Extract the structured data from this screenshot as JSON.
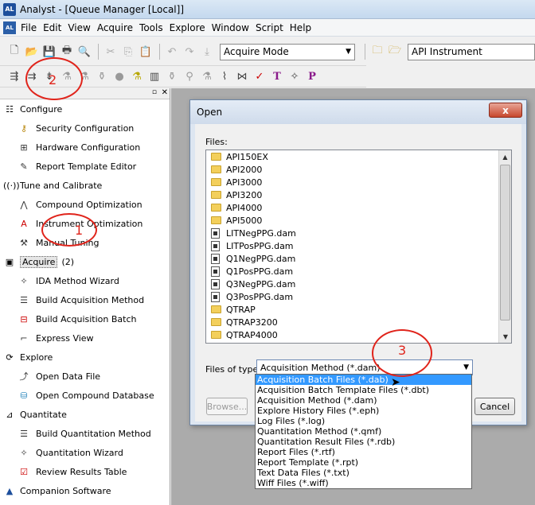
{
  "window": {
    "title": "Analyst - [Queue Manager [Local]]",
    "app_icon": "AL"
  },
  "menu": {
    "items": [
      "File",
      "Edit",
      "View",
      "Acquire",
      "Tools",
      "Explore",
      "Window",
      "Script",
      "Help"
    ]
  },
  "toolbar": {
    "mode_value": "Acquire Mode",
    "instrument_value": "API Instrument"
  },
  "sidebar": {
    "groups": [
      {
        "label": "Configure",
        "items": [
          "Security Configuration",
          "Hardware Configuration",
          "Report Template Editor"
        ]
      },
      {
        "label": "Tune and Calibrate",
        "items": [
          "Compound Optimization",
          "Instrument Optimization",
          "Manual Tuning"
        ]
      },
      {
        "label": "Acquire",
        "items": [
          "IDA Method Wizard",
          "Build Acquisition Method",
          "Build Acquisition Batch",
          "Express View"
        ]
      },
      {
        "label": "Explore",
        "items": [
          "Open Data File",
          "Open Compound Database"
        ]
      },
      {
        "label": "Quantitate",
        "items": [
          "Build Quantitation Method",
          "Quantitation Wizard",
          "Review Results Table"
        ]
      },
      {
        "label": "Companion Software",
        "items": []
      }
    ]
  },
  "dialog": {
    "title": "Open",
    "close_label": "x",
    "files_label": "Files:",
    "files": [
      {
        "name": "API150EX",
        "kind": "folder"
      },
      {
        "name": "API2000",
        "kind": "folder"
      },
      {
        "name": "API3000",
        "kind": "folder"
      },
      {
        "name": "API3200",
        "kind": "folder"
      },
      {
        "name": "API4000",
        "kind": "folder"
      },
      {
        "name": "API5000",
        "kind": "folder"
      },
      {
        "name": "LITNegPPG.dam",
        "kind": "file"
      },
      {
        "name": "LITPosPPG.dam",
        "kind": "file"
      },
      {
        "name": "Q1NegPPG.dam",
        "kind": "file"
      },
      {
        "name": "Q1PosPPG.dam",
        "kind": "file"
      },
      {
        "name": "Q3NegPPG.dam",
        "kind": "file"
      },
      {
        "name": "Q3PosPPG.dam",
        "kind": "file"
      },
      {
        "name": "QTRAP",
        "kind": "folder"
      },
      {
        "name": "QTRAP3200",
        "kind": "folder"
      },
      {
        "name": "QTRAP4000",
        "kind": "folder"
      }
    ],
    "files_of_type_label": "Files of type:",
    "files_of_type_value": "Acquisition Method (*.dam)",
    "browse_label": "Browse...",
    "cancel_label": "Cancel",
    "type_options": [
      "Acquisition Batch Files (*.dab)",
      "Acquisition Batch Template Files (*.dbt)",
      "Acquisition Method (*.dam)",
      "Explore History Files (*.eph)",
      "Log Files (*.log)",
      "Quantitation Method (*.qmf)",
      "Quantitation Result Files (*.rdb)",
      "Report Files (*.rtf)",
      "Report Template (*.rpt)",
      "Text Data Files (*.txt)",
      "Wiff Files (*.wiff)"
    ],
    "selected_option_index": 0
  },
  "annotations": {
    "one": "1",
    "acquire_count": "(2)",
    "two": "2",
    "three": "3"
  }
}
